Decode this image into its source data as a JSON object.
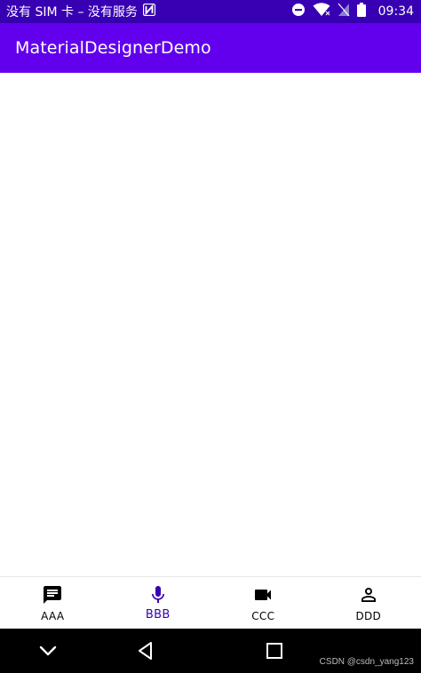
{
  "status_bar": {
    "carrier_text": "没有 SIM 卡 – 没有服务",
    "time": "09:34",
    "icons": [
      "nfc-icon",
      "do-not-disturb-icon",
      "wifi-icon",
      "no-sim-icon",
      "battery-icon"
    ]
  },
  "app_bar": {
    "title": "MaterialDesignerDemo"
  },
  "bottom_nav": {
    "items": [
      {
        "label": "AAA",
        "icon": "message-icon",
        "active": false
      },
      {
        "label": "BBB",
        "icon": "mic-icon",
        "active": true
      },
      {
        "label": "CCC",
        "icon": "videocam-icon",
        "active": false
      },
      {
        "label": "DDD",
        "icon": "person-icon",
        "active": false
      }
    ]
  },
  "system_nav": {
    "buttons": [
      "back-chevron-icon",
      "back-triangle-icon",
      "recents-square-icon"
    ]
  },
  "watermark": "CSDN @csdn_yang123",
  "colors": {
    "status_bar": "#3700b3",
    "app_bar": "#6200ee",
    "active_nav": "#3700b3",
    "system_nav": "#000000"
  }
}
